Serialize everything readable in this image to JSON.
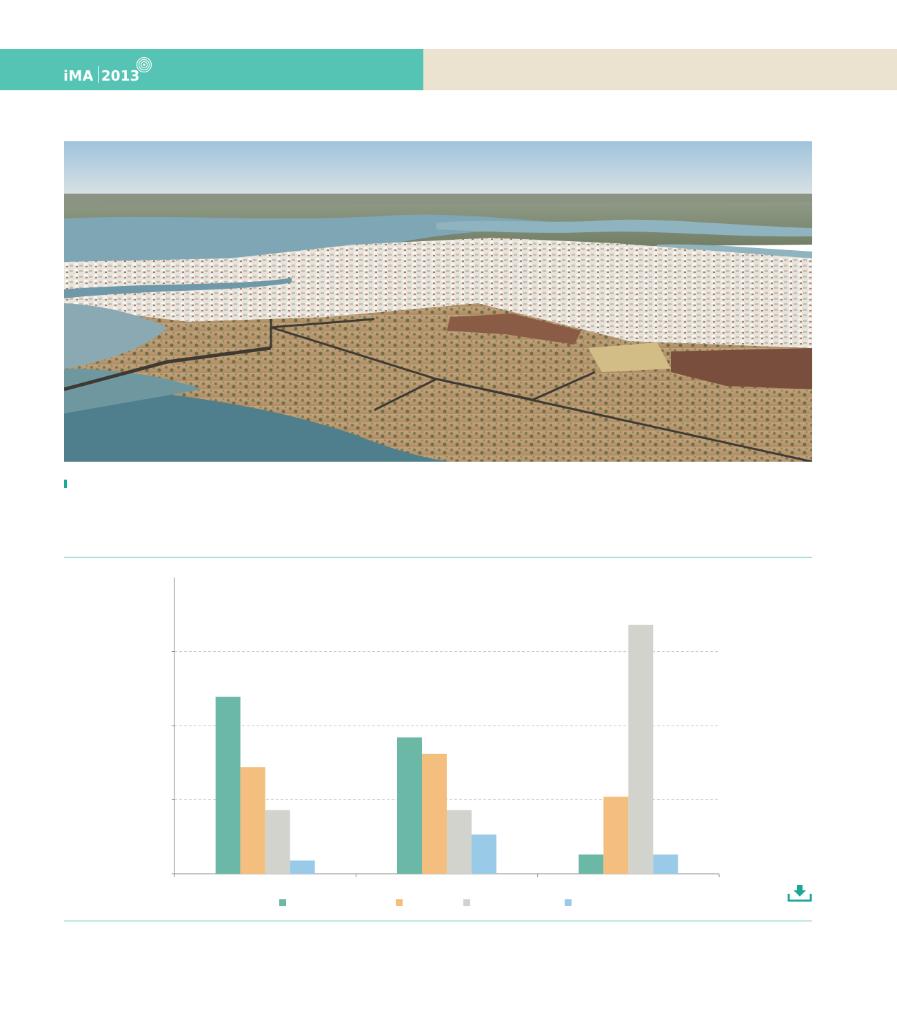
{
  "header": {
    "brand": "iMA",
    "year": "2013",
    "left_color": "#55c4b4",
    "right_color": "#ebe2cf"
  },
  "photo": {
    "subject": "aerial-photo-coastal-town-marshes-dunes"
  },
  "chart_data": {
    "type": "bar",
    "title": "",
    "xlabel": "",
    "ylabel": "",
    "categories": [
      "",
      "",
      ""
    ],
    "ylim": [
      0,
      4
    ],
    "gridlines": [
      1,
      2,
      3
    ],
    "grid": true,
    "legend_position": "bottom",
    "series": [
      {
        "color": "#6cb8a6",
        "values": [
          2.39,
          1.84,
          0.26
        ]
      },
      {
        "color": "#f3be7e",
        "values": [
          1.44,
          1.62,
          1.04
        ]
      },
      {
        "color": "#d3d3cd",
        "values": [
          0.86,
          0.86,
          3.36
        ]
      },
      {
        "color": "#99cbe8",
        "values": [
          0.18,
          0.53,
          0.26
        ]
      }
    ]
  },
  "icons": {
    "download": "download-icon",
    "caption_marker": "caption-marker"
  }
}
